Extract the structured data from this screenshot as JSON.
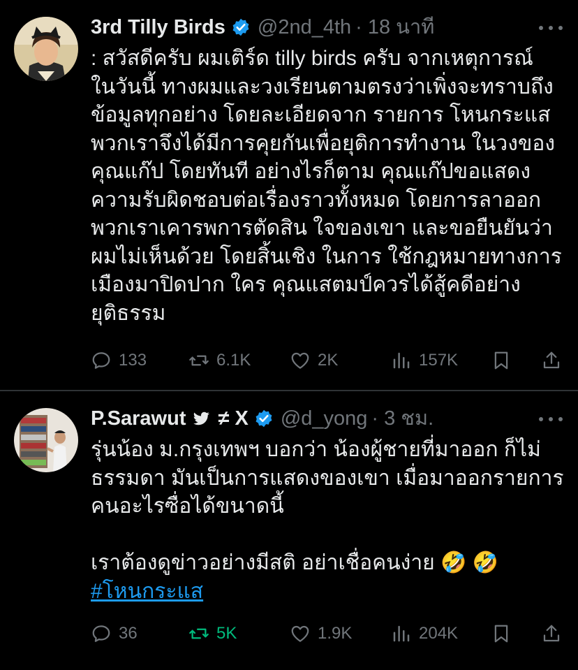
{
  "tweets": [
    {
      "name": "3rd Tilly Birds",
      "handle": "@2nd_4th",
      "time": "· 18 นาที",
      "text": ": สวัสดีครับ ผมเติร์ด tilly birds ครับ จากเหตุการณ์\nในวันนี้ ทางผมและวงเรียนตามตรงว่าเพิ่งจะทราบถึง\nข้อมูลทุกอย่าง โดยละเอียดจาก รายการ โหนกระแส\nพวกเราจึงได้มีการคุยกันเพื่อยุติการทำงาน ในวงของ\nคุณแก๊ป โดยทันที อย่างไรก็ตาม คุณแก๊ปขอแสดง\nความรับผิดชอบต่อเรื่องราวทั้งหมด โดยการลาออก\nพวกเราเคารพการตัดสิน ใจของเขา และขอยืนยันว่า\nผมไม่เห็นด้วย โดยสิ้นเชิง ในการ ใช้กฎหมายทางการ\nเมืองมาปิดปาก ใคร คุณแสตมป์ควรได้สู้คดีอย่าง\nยุติธรรม",
      "replies": "133",
      "reposts": "6.1K",
      "likes": "2K",
      "views": "157K",
      "avatar_icon": "person-with-cat-ear-headband"
    },
    {
      "name": "P.Sarawut",
      "name_suffix": "≠ X",
      "handle": "@d_yong",
      "time": "· 3 ชม.",
      "text_main": "รุ่นน้อง ม.กรุงเทพฯ บอกว่า น้องผู้ชายที่มาออก ก็ไม่\nธรรมดา มันเป็นการแสดงของเขา เมื่อมาออกรายการ\nคนอะไรซื่อได้ขนาดนี้\n\nเราต้องดูข่าวอย่างมีสติ อย่าเชื่อคนง่าย 🤣 🤣",
      "hashtag": "#โหนกระแส",
      "replies": "36",
      "reposts": "5K",
      "likes": "1.9K",
      "views": "204K",
      "avatar_icon": "person-near-shoe-rack"
    }
  ],
  "colors": {
    "background": "#000000",
    "text": "#e7e9ea",
    "muted": "#71767b",
    "accent": "#1d9bf0",
    "repost_active": "#00ba7c"
  }
}
